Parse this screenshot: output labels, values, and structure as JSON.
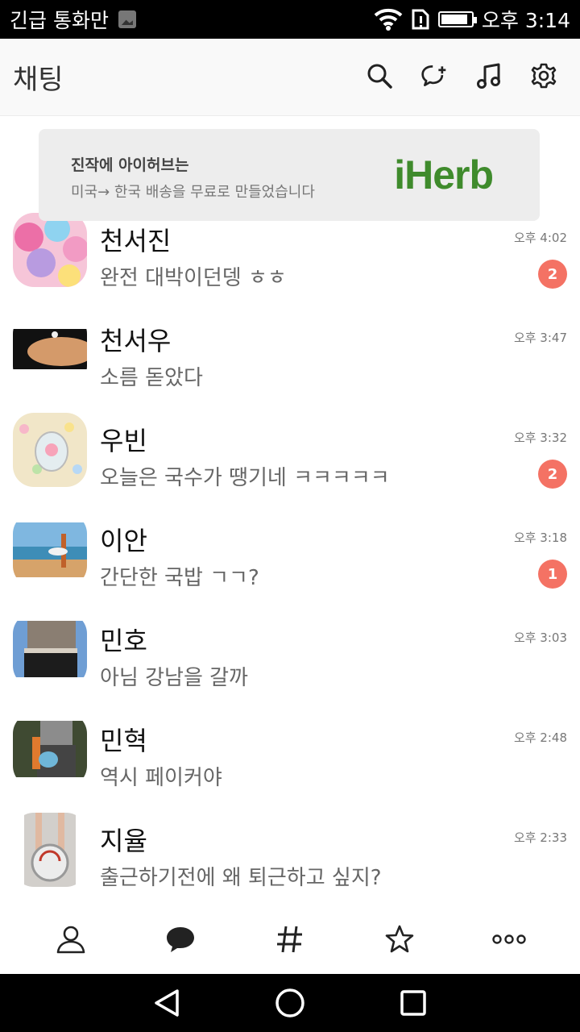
{
  "status_bar": {
    "left_text": "긴급 통화만",
    "time": "오후 3:14",
    "battery_level": 0.9
  },
  "header": {
    "title": "채팅",
    "icons": [
      "search-icon",
      "new-chat-icon",
      "music-icon",
      "settings-icon"
    ]
  },
  "ad": {
    "headline": "진작에 아이허브는",
    "sub": "미국→ 한국 배송을 무료로 만들었습니다",
    "brand": "iHerb",
    "brand_color": "#3f8b2c"
  },
  "chats": [
    {
      "name": "천서진",
      "message": "완전 대박이던뎅 ㅎㅎ",
      "time": "오후 4:02",
      "unread": "2"
    },
    {
      "name": "천서우",
      "message": "소름 돋았다",
      "time": "오후 3:47",
      "unread": ""
    },
    {
      "name": "우빈",
      "message": "오늘은 국수가 땡기네 ㅋㅋㅋㅋㅋ",
      "time": "오후 3:32",
      "unread": "2"
    },
    {
      "name": "이안",
      "message": "간단한 국밥 ㄱㄱ?",
      "time": "오후 3:18",
      "unread": "1"
    },
    {
      "name": "민호",
      "message": "아님 강남을 갈까",
      "time": "오후 3:03",
      "unread": ""
    },
    {
      "name": "민혁",
      "message": "역시 페이커야",
      "time": "오후 2:48",
      "unread": ""
    },
    {
      "name": "지율",
      "message": "출근하기전에 왜 퇴근하고 싶지?",
      "time": "오후 2:33",
      "unread": ""
    }
  ],
  "tabs": [
    "friends-icon",
    "chats-icon",
    "hashtag-icon",
    "star-icon",
    "more-icon"
  ],
  "colors": {
    "badge": "#f47264",
    "accent": "#333333"
  }
}
